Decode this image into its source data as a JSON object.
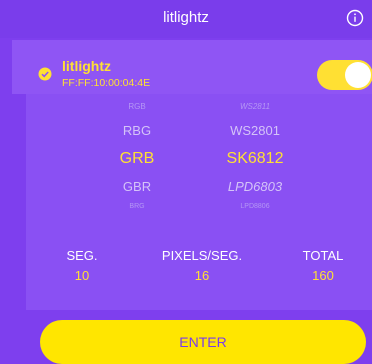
{
  "header": {
    "title": "litlightz"
  },
  "device": {
    "name": "litlightz",
    "mac": "FF:FF:10:00:04:4E",
    "enabled": true
  },
  "picker": {
    "rows": [
      {
        "order": "RGB",
        "chip": "WS2811"
      },
      {
        "order": "RBG",
        "chip": "WS2801"
      },
      {
        "order": "GRB",
        "chip": "SK6812"
      },
      {
        "order": "GBR",
        "chip": "LPD6803"
      },
      {
        "order": "BRG",
        "chip": "LPD8806"
      }
    ],
    "selected_index": 2
  },
  "stats": {
    "seg_label": "SEG.",
    "seg_value": "10",
    "pps_label": "PIXELS/SEG.",
    "pps_value": "16",
    "total_label": "TOTAL",
    "total_value": "160"
  },
  "action": {
    "enter_label": "ENTER"
  },
  "colors": {
    "background": "#7e3fee",
    "accent": "#ffe033",
    "panel": "#8a50f3"
  }
}
